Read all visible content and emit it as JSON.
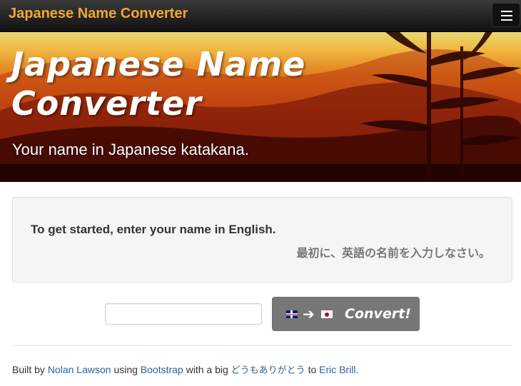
{
  "navbar": {
    "brand": "Japanese Name Converter",
    "menu_icon": "hamburger-icon"
  },
  "hero": {
    "title": "Japanese Name Converter",
    "subtitle": "Your name in Japanese katakana."
  },
  "instructions": {
    "english": "To get started, enter your name in English.",
    "japanese": "最初に、英語の名前を入力しなさい。"
  },
  "form": {
    "name_value": "",
    "convert_label": "Convert!",
    "flag_from": "uk-flag-icon",
    "flag_to": "japan-flag-icon",
    "arrow": "➔"
  },
  "footer": {
    "built_by": "Built by",
    "author": "Nolan Lawson",
    "using": "using",
    "tool": "Bootstrap",
    "with": "with a big",
    "thanks": "どうもありがとう",
    "to": "to",
    "thanked": "Eric Brill",
    "end": "."
  },
  "colors": {
    "brand": "#f0a830",
    "button": "#777777",
    "link": "#2a6496"
  }
}
